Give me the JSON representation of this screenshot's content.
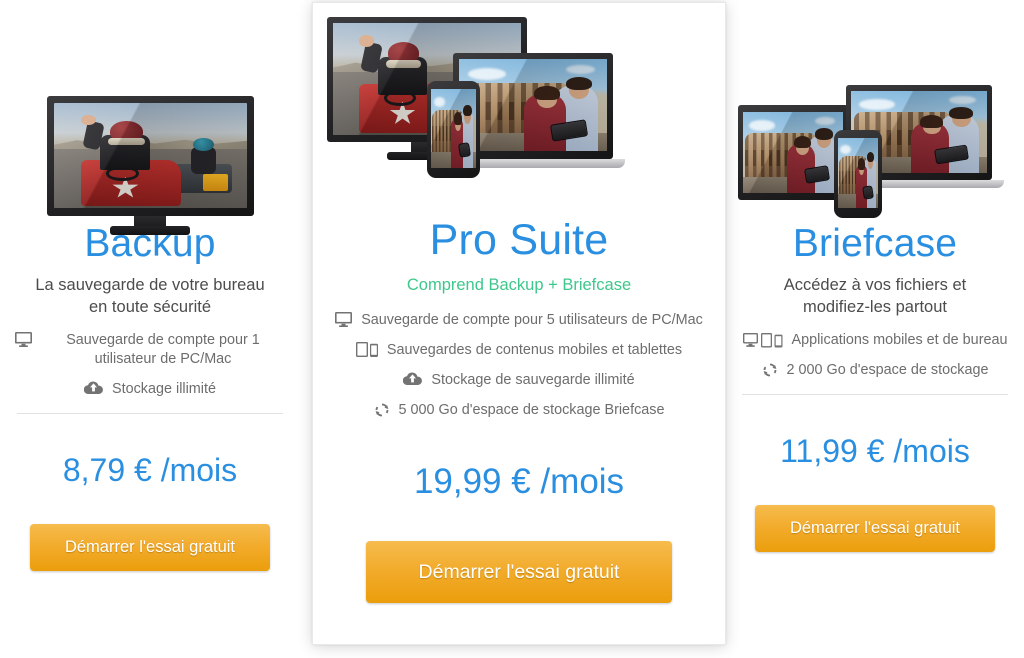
{
  "page": {
    "accent_blue": "#2a8fe0",
    "accent_green": "#3ec78c",
    "cta_orange_top": "#f6bc4e",
    "cta_orange_bottom": "#eb9e0c",
    "text_gray": "#6d6d6d",
    "tagline_gray": "#4c4c4c",
    "divider_gray": "#e2e2e2",
    "background": "#ffffff"
  },
  "plans": [
    {
      "id": "backup",
      "featured": false,
      "title": "Backup",
      "tagline": "La sauvegarde de votre bureau en toute sécurité",
      "tagline_line1": "La sauvegarde de votre bureau",
      "tagline_line2": "en toute sécurité",
      "subtitle": "",
      "hero_alt": "Écran d'ordinateur affichant une photo d'enfants en caisse à savon",
      "features": [
        {
          "icon": "monitor-icon",
          "text": "Sauvegarde de compte pour 1 utilisateur de PC/Mac"
        },
        {
          "icon": "cloud-upload-icon",
          "text": "Stockage illimité"
        }
      ],
      "price": "8,79 € /mois",
      "price_amount": "8,79 €",
      "price_period": "/mois",
      "cta_label": "Démarrer l'essai gratuit"
    },
    {
      "id": "pro-suite",
      "featured": true,
      "title": "Pro Suite",
      "tagline": "",
      "subtitle": "Comprend Backup + Briefcase",
      "hero_alt": "Écran, ordinateur portable et smartphone affichant des photos",
      "features": [
        {
          "icon": "monitor-icon",
          "text": "Sauvegarde de compte pour 5 utilisateurs de PC/Mac"
        },
        {
          "icon": "tablet-phone-icon",
          "text": "Sauvegardes de contenus mobiles et tablettes"
        },
        {
          "icon": "cloud-upload-icon",
          "text": "Stockage de sauvegarde illimité"
        },
        {
          "icon": "sync-icon",
          "text": "5 000 Go d'espace de stockage Briefcase"
        }
      ],
      "price": "19,99 € /mois",
      "price_amount": "19,99 €",
      "price_period": "/mois",
      "cta_label": "Démarrer l'essai gratuit"
    },
    {
      "id": "briefcase",
      "featured": false,
      "title": "Briefcase",
      "tagline": "Accédez à vos fichiers et modifiez-les partout",
      "tagline_line1": "Accédez à vos fichiers et",
      "tagline_line2": "modifiez-les partout",
      "subtitle": "",
      "hero_alt": "Tablette, ordinateur portable et smartphone affichant des photos",
      "features": [
        {
          "icon": "monitor-tablet-phone-icon",
          "text": "Applications mobiles et de bureau"
        },
        {
          "icon": "sync-icon",
          "text": "2 000 Go d'espace de stockage"
        }
      ],
      "price": "11,99 € /mois",
      "price_amount": "11,99 €",
      "price_period": "/mois",
      "cta_label": "Démarrer l'essai gratuit"
    }
  ]
}
